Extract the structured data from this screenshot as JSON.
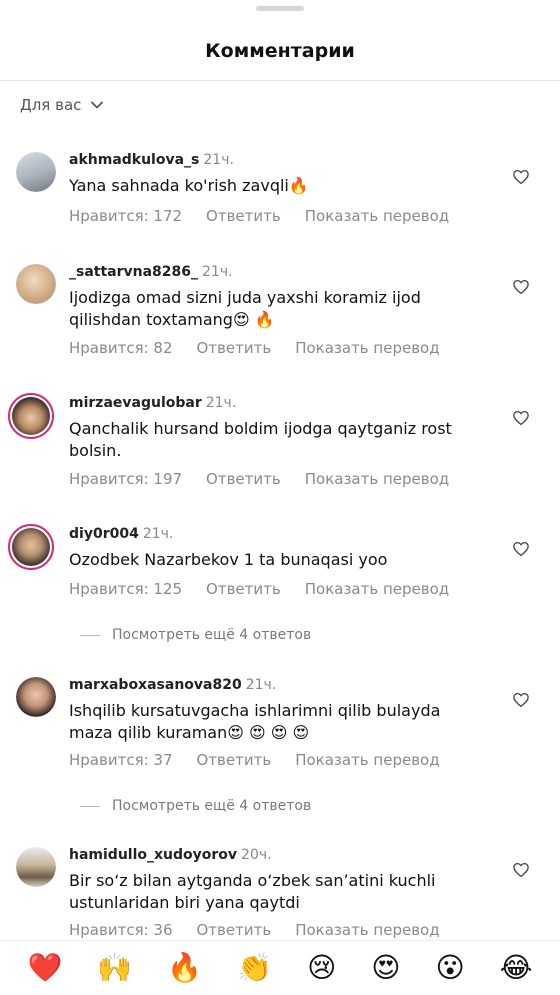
{
  "header": {
    "title": "Комментарии"
  },
  "filter": {
    "label": "Для вас"
  },
  "comments": [
    {
      "username": "akhmadkulova_s",
      "time": "21ч.",
      "text": "Yana sahnada ko'rish zavqli🔥",
      "likes": "Нравится: 172",
      "reply": "Ответить",
      "translate": "Показать перевод"
    },
    {
      "username": "_sattarvna8286_",
      "time": "21ч.",
      "text": "Ijodizga omad sizni juda yaxshi koramiz ijod qilishdan toxtamang😍 🔥",
      "likes": "Нравится: 82",
      "reply": "Ответить",
      "translate": "Показать перевод"
    },
    {
      "username": "mirzaevagulobar",
      "time": "21ч.",
      "text": "Qanchalik hursand boldim ijodga qaytganiz rost bolsin.",
      "likes": "Нравится: 197",
      "reply": "Ответить",
      "translate": "Показать перевод"
    },
    {
      "username": "diy0r004",
      "time": "21ч.",
      "text": "Ozodbek Nazarbekov 1 ta bunaqasi yoo",
      "likes": "Нравится: 125",
      "reply": "Ответить",
      "translate": "Показать перевод"
    },
    {
      "username": "marxaboxasanova820",
      "time": "21ч.",
      "text": "Ishqilib kursatuvgacha ishlarimni qilib bulayda maza qilib kuraman😍 😍 😍 😍",
      "likes": "Нравится: 37",
      "reply": "Ответить",
      "translate": "Показать перевод"
    },
    {
      "username": "hamidullo_xudoyorov",
      "time": "20ч.",
      "text": "Bir so‘z bilan aytganda o‘zbek san’atini kuchli ustunlaridan biri yana qaytdi",
      "likes": "Нравится: 36",
      "reply": "Ответить",
      "translate": "Показать перевод"
    }
  ],
  "view_more": [
    {
      "label": "Посмотреть ещё 4 ответов"
    },
    {
      "label": "Посмотреть ещё 4 ответов"
    }
  ],
  "emoji_bar": [
    "❤️",
    "🙌",
    "🔥",
    "👏",
    "😢",
    "😍",
    "😮",
    "😂"
  ],
  "colors": {
    "ring": "#d62976",
    "muted": "#8a8a8a"
  }
}
